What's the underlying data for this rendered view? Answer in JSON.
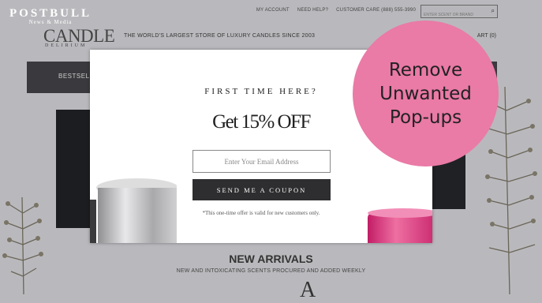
{
  "watermark": {
    "main": "POSTBULL",
    "sub": "News & Media"
  },
  "site": {
    "logo": {
      "main": "CANDLE",
      "sub": "DELIRIUM"
    },
    "top_links": [
      "MY ACCOUNT",
      "NEED HELP?",
      "CUSTOMER CARE (888) 555-3990"
    ],
    "search_placeholder": "ENTER SCENT OR BRAND",
    "tagline": "THE WORLD'S LARGEST STORE OF LUXURY CANDLES SINCE 2003",
    "cart_fragment": "ART (0)",
    "nav_item": "BESTSELLE",
    "new_arrivals_title": "NEW ARRIVALS",
    "new_arrivals_sub": "NEW AND INTOXICATING SCENTS PROCURED AND ADDED WEEKLY",
    "bottom_script": "A"
  },
  "popup": {
    "heading": "FIRST TIME HERE?",
    "offer": "Get 15% OFF",
    "email_placeholder": "Enter Your Email Address",
    "button_label": "SEND ME A COUPON",
    "disclaimer": "*This one-time offer is valid for new customers only."
  },
  "badge": {
    "lines": [
      "Remove",
      "Unwanted",
      "Pop-ups"
    ]
  },
  "colors": {
    "overlay": "#b9b9bd",
    "badge": "#ea7aa6",
    "button": "#2e2e30",
    "navbar": "#3a3a3e"
  }
}
